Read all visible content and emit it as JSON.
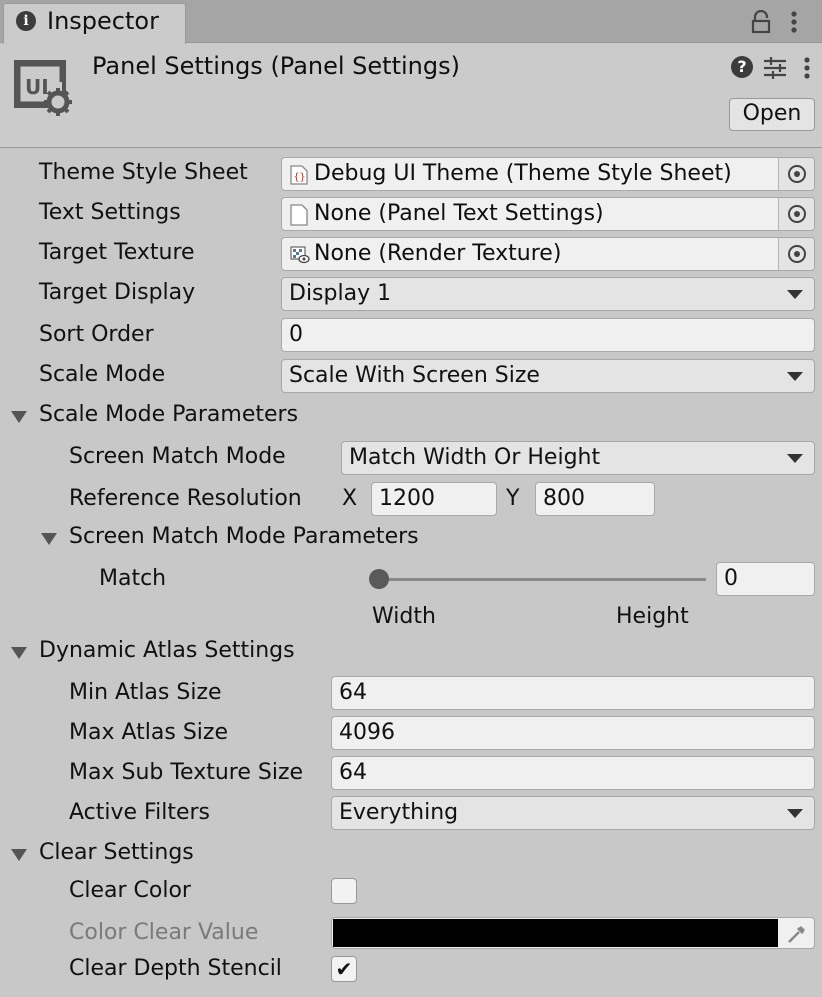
{
  "tab": {
    "title": "Inspector"
  },
  "header": {
    "title": "Panel Settings (Panel Settings)",
    "open_label": "Open"
  },
  "fields": {
    "theme_style_sheet": {
      "label": "Theme Style Sheet",
      "value": "Debug UI Theme (Theme Style Sheet)"
    },
    "text_settings": {
      "label": "Text Settings",
      "value": "None (Panel Text Settings)"
    },
    "target_texture": {
      "label": "Target Texture",
      "value": "None (Render Texture)"
    },
    "target_display": {
      "label": "Target Display",
      "value": "Display 1"
    },
    "sort_order": {
      "label": "Sort Order",
      "value": "0"
    },
    "scale_mode": {
      "label": "Scale Mode",
      "value": "Scale With Screen Size"
    }
  },
  "scale_mode_parameters": {
    "title": "Scale Mode Parameters",
    "screen_match_mode": {
      "label": "Screen Match Mode",
      "value": "Match Width Or Height"
    },
    "reference_resolution": {
      "label": "Reference Resolution",
      "x_label": "X",
      "x_value": "1200",
      "y_label": "Y",
      "y_value": "800"
    },
    "screen_match_mode_parameters": {
      "title": "Screen Match Mode Parameters",
      "match": {
        "label": "Match",
        "value": "0",
        "slider_fraction": 0,
        "min_label": "Width",
        "max_label": "Height"
      }
    }
  },
  "dynamic_atlas_settings": {
    "title": "Dynamic Atlas Settings",
    "min_atlas_size": {
      "label": "Min Atlas Size",
      "value": "64"
    },
    "max_atlas_size": {
      "label": "Max Atlas Size",
      "value": "4096"
    },
    "max_sub_texture_size": {
      "label": "Max Sub Texture Size",
      "value": "64"
    },
    "active_filters": {
      "label": "Active Filters",
      "value": "Everything"
    }
  },
  "clear_settings": {
    "title": "Clear Settings",
    "clear_color": {
      "label": "Clear Color",
      "checked": false
    },
    "color_clear_value": {
      "label": "Color Clear Value",
      "color": "#000000"
    },
    "clear_depth_stencil": {
      "label": "Clear Depth Stencil",
      "checked": true,
      "check_glyph": "✔"
    }
  },
  "colors": {
    "panel_bg": "#c8c8c8",
    "field_bg": "#f0f0f0",
    "dropdown_bg": "#e4e4e4",
    "tabbar_bg": "#a5a5a5"
  }
}
